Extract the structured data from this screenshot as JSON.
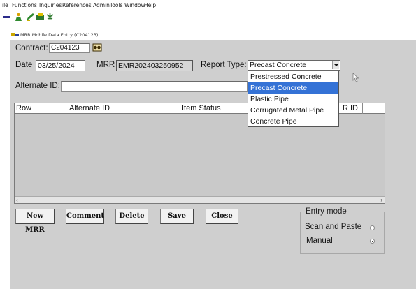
{
  "menubar": {
    "items": [
      "ile",
      "Functions",
      "Inquiries",
      "References",
      "Admin",
      "Tools",
      "Window",
      "Help"
    ]
  },
  "toolbar": {
    "icons": [
      "minimize-icon",
      "person-icon",
      "edit-icon",
      "print-icon",
      "tree-icon"
    ]
  },
  "window": {
    "title": "MRR Mobile Data Entry (C204123)"
  },
  "form": {
    "contract_label": "Contract:",
    "contract_value": "C204123",
    "date_label": "Date",
    "date_value": "03/25/2024",
    "mrr_label": "MRR",
    "mrr_value": "EMR202403250952",
    "report_type_label": "Report Type:",
    "report_type_value": "Precast Concrete",
    "alternate_id_label": "Alternate ID:",
    "alternate_id_value": ""
  },
  "report_type_options": [
    {
      "label": "Prestressed Concrete",
      "selected": false
    },
    {
      "label": "Precast Concrete",
      "selected": true
    },
    {
      "label": "Plastic Pipe",
      "selected": false
    },
    {
      "label": "Corrugated Metal Pipe",
      "selected": false
    },
    {
      "label": "Concrete Pipe",
      "selected": false
    }
  ],
  "grid": {
    "columns": [
      "Row",
      "Alternate ID",
      "Item Status",
      "R ID"
    ],
    "rows": []
  },
  "buttons": {
    "new_mrr": "New MRR",
    "comment": "Comment",
    "delete": "Delete",
    "save": "Save",
    "close": "Close"
  },
  "entry_mode": {
    "title": "Entry mode",
    "options": [
      {
        "label": "Scan and Paste",
        "selected": false
      },
      {
        "label": "Manual",
        "selected": true
      }
    ]
  },
  "colors": {
    "window_bg": "#cfcfcf",
    "selection": "#3472d6"
  }
}
